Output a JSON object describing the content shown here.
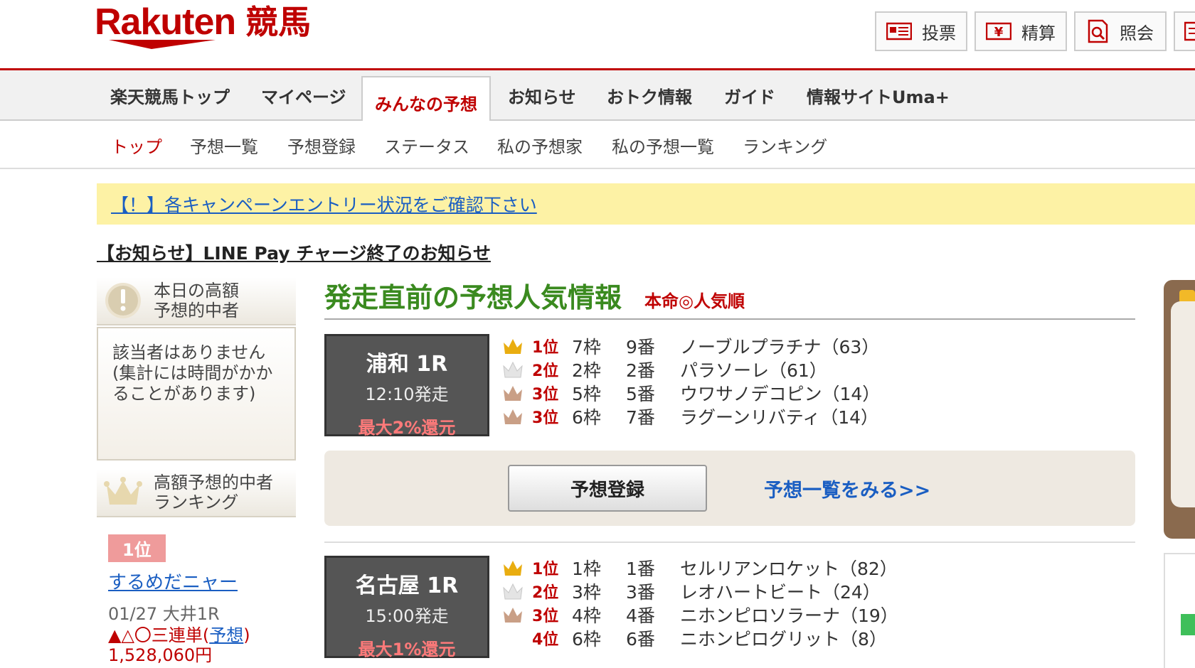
{
  "header": {
    "logo_main": "Rakuten",
    "logo_sub": "競馬",
    "util_buttons": [
      {
        "label": "投票",
        "icon": "ballot-icon"
      },
      {
        "label": "精算",
        "icon": "yen-icon"
      },
      {
        "label": "照会",
        "icon": "search-document-icon"
      }
    ]
  },
  "global_nav": {
    "items": [
      {
        "label": "楽天競馬トップ"
      },
      {
        "label": "マイページ"
      },
      {
        "label": "みんなの予想",
        "active": true
      },
      {
        "label": "お知らせ"
      },
      {
        "label": "おトク情報"
      },
      {
        "label": "ガイド"
      },
      {
        "label": "情報サイトUma+"
      }
    ]
  },
  "sub_nav": {
    "items": [
      {
        "label": "トップ",
        "active": true
      },
      {
        "label": "予想一覧"
      },
      {
        "label": "予想登録"
      },
      {
        "label": "ステータス"
      },
      {
        "label": "私の予想家"
      },
      {
        "label": "私の予想一覧"
      },
      {
        "label": "ランキング"
      }
    ]
  },
  "banner": {
    "text": "【！】各キャンペーンエントリー状況をご確認下さい"
  },
  "news": {
    "text": "【お知らせ】LINE Pay チャージ終了のお知らせ"
  },
  "sidebar": {
    "today_high": {
      "title_line1": "本日の高額",
      "title_line2": "予想的中者",
      "body": "該当者はありません(集計には時間がかかることがあります)"
    },
    "ranking": {
      "title_line1": "高額予想的中者",
      "title_line2": "ランキング",
      "rank_badge": "1位",
      "user": "するめだニャー",
      "meta": "01/27 大井1R",
      "bet_prefix": "▲△〇三連単(",
      "bet_link": "予想",
      "bet_suffix": ")",
      "amount": "1,528,060円"
    }
  },
  "main": {
    "title": "発走直前の予想人気情報",
    "subtitle": "本命◎人気順",
    "races": [
      {
        "name": "浦和 1R",
        "time": "12:10発走",
        "cashback": "最大2%還元",
        "picks": [
          {
            "rank": "1位",
            "crown": "gold",
            "waku": "7枠",
            "num": "9番",
            "horse": "ノーブルプラチナ（63）"
          },
          {
            "rank": "2位",
            "crown": "silver",
            "waku": "2枠",
            "num": "2番",
            "horse": "パラソーレ（61）"
          },
          {
            "rank": "3位",
            "crown": "bronze",
            "waku": "5枠",
            "num": "5番",
            "horse": "ウワサノデコピン（14）"
          },
          {
            "rank": "3位",
            "crown": "bronze",
            "waku": "6枠",
            "num": "7番",
            "horse": "ラグーンリバティ（14）"
          }
        ]
      },
      {
        "name": "名古屋 1R",
        "time": "15:00発走",
        "cashback": "最大1%還元",
        "picks": [
          {
            "rank": "1位",
            "crown": "gold",
            "waku": "1枠",
            "num": "1番",
            "horse": "セルリアンロケット（82）"
          },
          {
            "rank": "2位",
            "crown": "silver",
            "waku": "3枠",
            "num": "3番",
            "horse": "レオハートビート（24）"
          },
          {
            "rank": "3位",
            "crown": "bronze",
            "waku": "4枠",
            "num": "4番",
            "horse": "ニホンピロソラーナ（19）"
          },
          {
            "rank": "4位",
            "crown": "none",
            "waku": "6枠",
            "num": "6番",
            "horse": "ニホンピログリット（8）"
          }
        ]
      }
    ],
    "register_button": "予想登録",
    "list_link": "予想一覧をみる>>"
  },
  "colors": {
    "brand_red": "#bf0000",
    "title_green": "#3a8a1f",
    "link_blue": "#1a5ec2",
    "banner_yellow": "#fdf2a5"
  }
}
